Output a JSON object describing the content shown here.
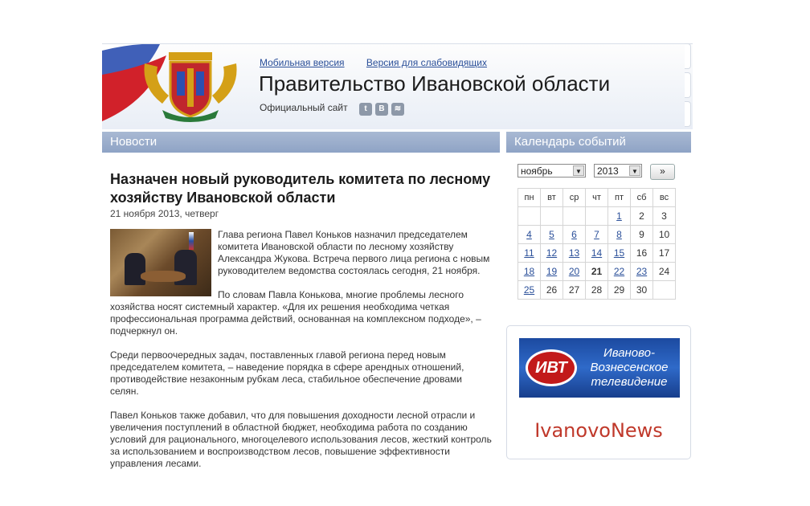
{
  "header": {
    "links": [
      "Мобильная версия",
      "Версия для слабовидящих"
    ],
    "title": "Правительство Ивановской области",
    "subtitle": "Официальный сайт",
    "social": [
      "twitter-icon",
      "vkontakte-icon",
      "rss-icon"
    ],
    "social_glyphs": [
      "t",
      "B",
      "≋"
    ]
  },
  "news": {
    "heading": "Новости",
    "article": {
      "title": "Назначен новый руководитель комитета по лесному хозяйству Ивановской области",
      "date": "21 ноября 2013, четверг",
      "p1": "Глава региона Павел Коньков назначил председателем комитета Ивановской области по лесному хозяйству Александра Жукова. Встреча первого лица региона с новым руководителем ведомства состоялась сегодня, 21 ноября.",
      "p2": "По словам Павла Конькова, многие проблемы лесного хозяйства носят системный характер. «Для их решения необходима четкая профессиональная программа действий, основанная на комплексном подходе», – подчеркнул он.",
      "p3": "Среди первоочередных задач, поставленных главой региона перед новым председателем комитета, – наведение порядка в сфере арендных отношений, противодействие незаконным рубкам леса, стабильное обеспечение дровами селян.",
      "p4": "Павел Коньков также добавил, что для повышения доходности лесной отрасли и увеличения поступлений в областной бюджет, необходима работа по созданию условий для рационального, многоцелевого использования лесов, жесткий контроль за использованием и воспроизводством лесов, повышение эффективности управления лесами."
    }
  },
  "calendar": {
    "heading": "Календарь событий",
    "month": "ноябрь",
    "year": "2013",
    "next": "»",
    "weekdays": [
      "пн",
      "вт",
      "ср",
      "чт",
      "пт",
      "сб",
      "вс"
    ],
    "weeks": [
      [
        [
          "",
          0
        ],
        [
          "",
          0
        ],
        [
          "",
          0
        ],
        [
          "",
          0
        ],
        [
          "1",
          1
        ],
        [
          "2",
          0
        ],
        [
          "3",
          0
        ]
      ],
      [
        [
          "4",
          1
        ],
        [
          "5",
          1
        ],
        [
          "6",
          1
        ],
        [
          "7",
          1
        ],
        [
          "8",
          1
        ],
        [
          "9",
          0
        ],
        [
          "10",
          0
        ]
      ],
      [
        [
          "11",
          1
        ],
        [
          "12",
          1
        ],
        [
          "13",
          1
        ],
        [
          "14",
          1
        ],
        [
          "15",
          1
        ],
        [
          "16",
          0
        ],
        [
          "17",
          0
        ]
      ],
      [
        [
          "18",
          1
        ],
        [
          "19",
          1
        ],
        [
          "20",
          1
        ],
        [
          "21",
          2
        ],
        [
          "22",
          1
        ],
        [
          "23",
          1
        ],
        [
          "24",
          0
        ]
      ],
      [
        [
          "25",
          1
        ],
        [
          "26",
          0
        ],
        [
          "27",
          0
        ],
        [
          "28",
          0
        ],
        [
          "29",
          0
        ],
        [
          "30",
          0
        ],
        [
          "",
          0
        ]
      ]
    ]
  },
  "banners": {
    "ivt_logo": "ИВТ",
    "ivt_text": "Иваново-Вознесенское телевидение",
    "ivanovonews": "IvanovoNews"
  },
  "colors": {
    "bar": "#8ea3c5",
    "link": "#2a4f99",
    "ivanovonews": "#c0392b"
  }
}
